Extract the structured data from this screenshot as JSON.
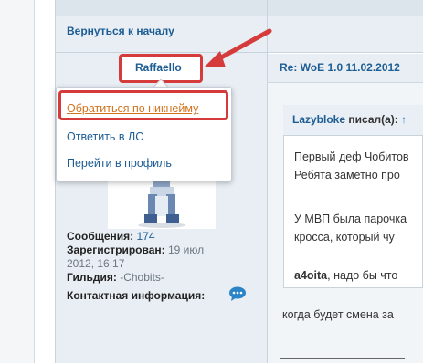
{
  "nav": {
    "back_link": "Вернуться к началу"
  },
  "post": {
    "author": "Raffaello",
    "title": "Re: WoE 1.0 11.02.2012",
    "body_line": "когда будет смена за"
  },
  "author_menu": {
    "items": [
      {
        "label": "Обратиться по никнейму"
      },
      {
        "label": "Ответить в ЛС"
      },
      {
        "label": "Перейти в профиль"
      }
    ]
  },
  "profile": {
    "messages_label": "Сообщения:",
    "messages_value": "174",
    "registered_label": "Зарегистрирован:",
    "registered_value_1": "19 июл",
    "registered_value_2": "2012, 16:17",
    "guild_label": "Гильдия:",
    "guild_value": "-Chobits-",
    "contact_label": "Контактная информация:",
    "contact_icon": "chat-bubble-icon"
  },
  "quote": {
    "author": "Lazybloke",
    "suffix": "писал(а):",
    "up_icon": "↑",
    "lines": [
      "Первый деф Чобитов",
      "Ребята заметно про",
      "У МВП была парочка",
      "кросса, который чу",
      "a4oita, надо бы что"
    ],
    "bold_name": "a4oita"
  },
  "colors": {
    "link": "#1d5d94",
    "highlight": "#d63b3b",
    "active_menu": "#d1741f"
  }
}
